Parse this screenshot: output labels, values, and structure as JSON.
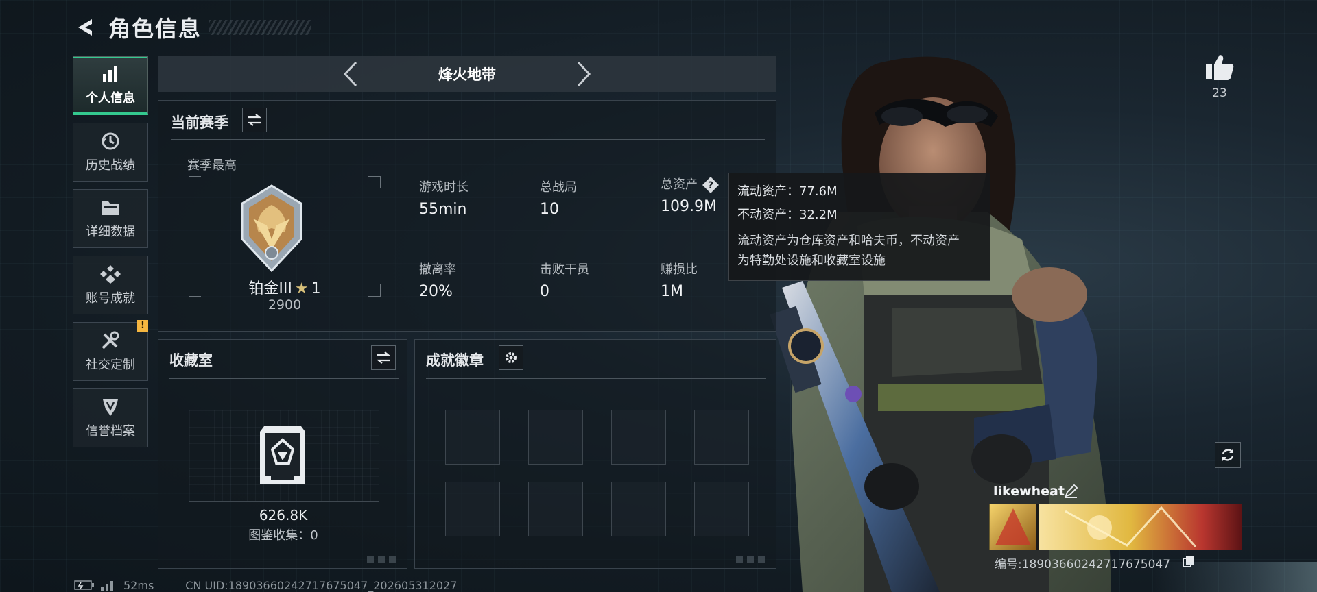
{
  "header": {
    "title": "角色信息"
  },
  "sidenav": {
    "items": [
      {
        "label": "个人信息",
        "icon": "bar-chart-icon",
        "active": true
      },
      {
        "label": "历史战绩",
        "icon": "history-icon",
        "active": false
      },
      {
        "label": "详细数据",
        "icon": "folder-icon",
        "active": false
      },
      {
        "label": "账号成就",
        "icon": "achievement-icon",
        "active": false
      },
      {
        "label": "社交定制",
        "icon": "tools-icon",
        "active": false,
        "badge": "!"
      },
      {
        "label": "信誉档案",
        "icon": "credit-shield-icon",
        "active": false
      }
    ]
  },
  "mode": {
    "title": "烽火地带"
  },
  "season": {
    "title": "当前赛季",
    "best_label": "赛季最高",
    "rank_name": "铂金III",
    "rank_stars": "1",
    "rank_score": "2900",
    "stats": {
      "play_time": {
        "label": "游戏时长",
        "value": "55min"
      },
      "total_matches": {
        "label": "总战局",
        "value": "10"
      },
      "total_assets": {
        "label": "总资产",
        "value": "109.9M"
      },
      "extract_rate": {
        "label": "撤离率",
        "value": "20%"
      },
      "kills": {
        "label": "击败干员",
        "value": "0"
      },
      "profit_ratio": {
        "label": "赚损比",
        "value": "1M"
      }
    }
  },
  "tooltip": {
    "liquid": "流动资产：77.6M",
    "fixed": "不动资产：32.2M",
    "desc_line1": "流动资产为仓库资产和哈夫币，不动资产",
    "desc_line2": "为特勤处设施和收藏室设施"
  },
  "collection": {
    "title": "收藏室",
    "value": "626.8K",
    "collect": "图鉴收集：0"
  },
  "badges": {
    "title": "成就徽章",
    "slots": 8
  },
  "profile": {
    "likes": "23",
    "username": "likewheat",
    "player_id": "编号:18903660242717675047"
  },
  "footer": {
    "ping": "52ms",
    "uid": "CN UID:18903660242717675047_202605312027"
  },
  "colors": {
    "accent": "#34c98f",
    "warning": "#f5b640",
    "panel_bg": "#12191f"
  }
}
